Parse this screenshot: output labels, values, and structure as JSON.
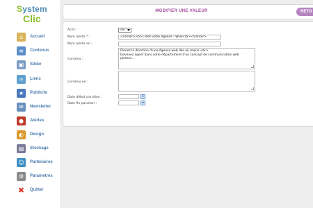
{
  "logo": {
    "line1_a": "S",
    "line1_b": "ystem",
    "line2": "Clic"
  },
  "sidebar": {
    "items": [
      {
        "label": "Accueil",
        "icon": "home-icon",
        "color": "#d9b35a"
      },
      {
        "label": "Contenus",
        "icon": "contents-icon",
        "color": "#5a8ec9"
      },
      {
        "label": "Slider",
        "icon": "slider-icon",
        "color": "#7b9cc4"
      },
      {
        "label": "Liens",
        "icon": "links-icon",
        "color": "#5fa0d0"
      },
      {
        "label": "Publicite",
        "icon": "ad-icon",
        "color": "#4a78c0"
      },
      {
        "label": "Newsletter",
        "icon": "newsletter-icon",
        "color": "#6a8fbf"
      },
      {
        "label": "Alertes",
        "icon": "alert-icon",
        "color": "#c0392b"
      },
      {
        "label": "Design",
        "icon": "palette-icon",
        "color": "#d99a2b"
      },
      {
        "label": "Stockage",
        "icon": "storage-icon",
        "color": "#7a7a9a"
      },
      {
        "label": "Partenaires",
        "icon": "partners-icon",
        "color": "#3f8fc4"
      },
      {
        "label": "Parametres",
        "icon": "gear-icon",
        "color": "#8a8a8a"
      },
      {
        "label": "Quitter",
        "icon": "close-icon",
        "color": "#d9352a"
      }
    ]
  },
  "header": {
    "title": "MODIFIER UNE VALEUR",
    "button": "RETO"
  },
  "form": {
    "actif_label": "Actif :",
    "actif_value": "oui",
    "nom_fr_label": "Nom alerte * :",
    "nom_fr_value": "<center><b>Créez votre Agence - WEB</b></center>",
    "nom_en_label": "Nom alerte en :",
    "nom_en_value": "",
    "contenu_label": "Contenu :",
    "contenu_line1": "Prenez la direction d'une Agence web dès en mains <br>",
    "contenu_line2": "Devenez agent dans votre département d'un concept de communication web porteur...",
    "contenu_en_label": "Contenu en :",
    "contenu_en_value": "",
    "date_debut_label": "Date début parution :",
    "date_fin_label": "Date fin parution :"
  }
}
